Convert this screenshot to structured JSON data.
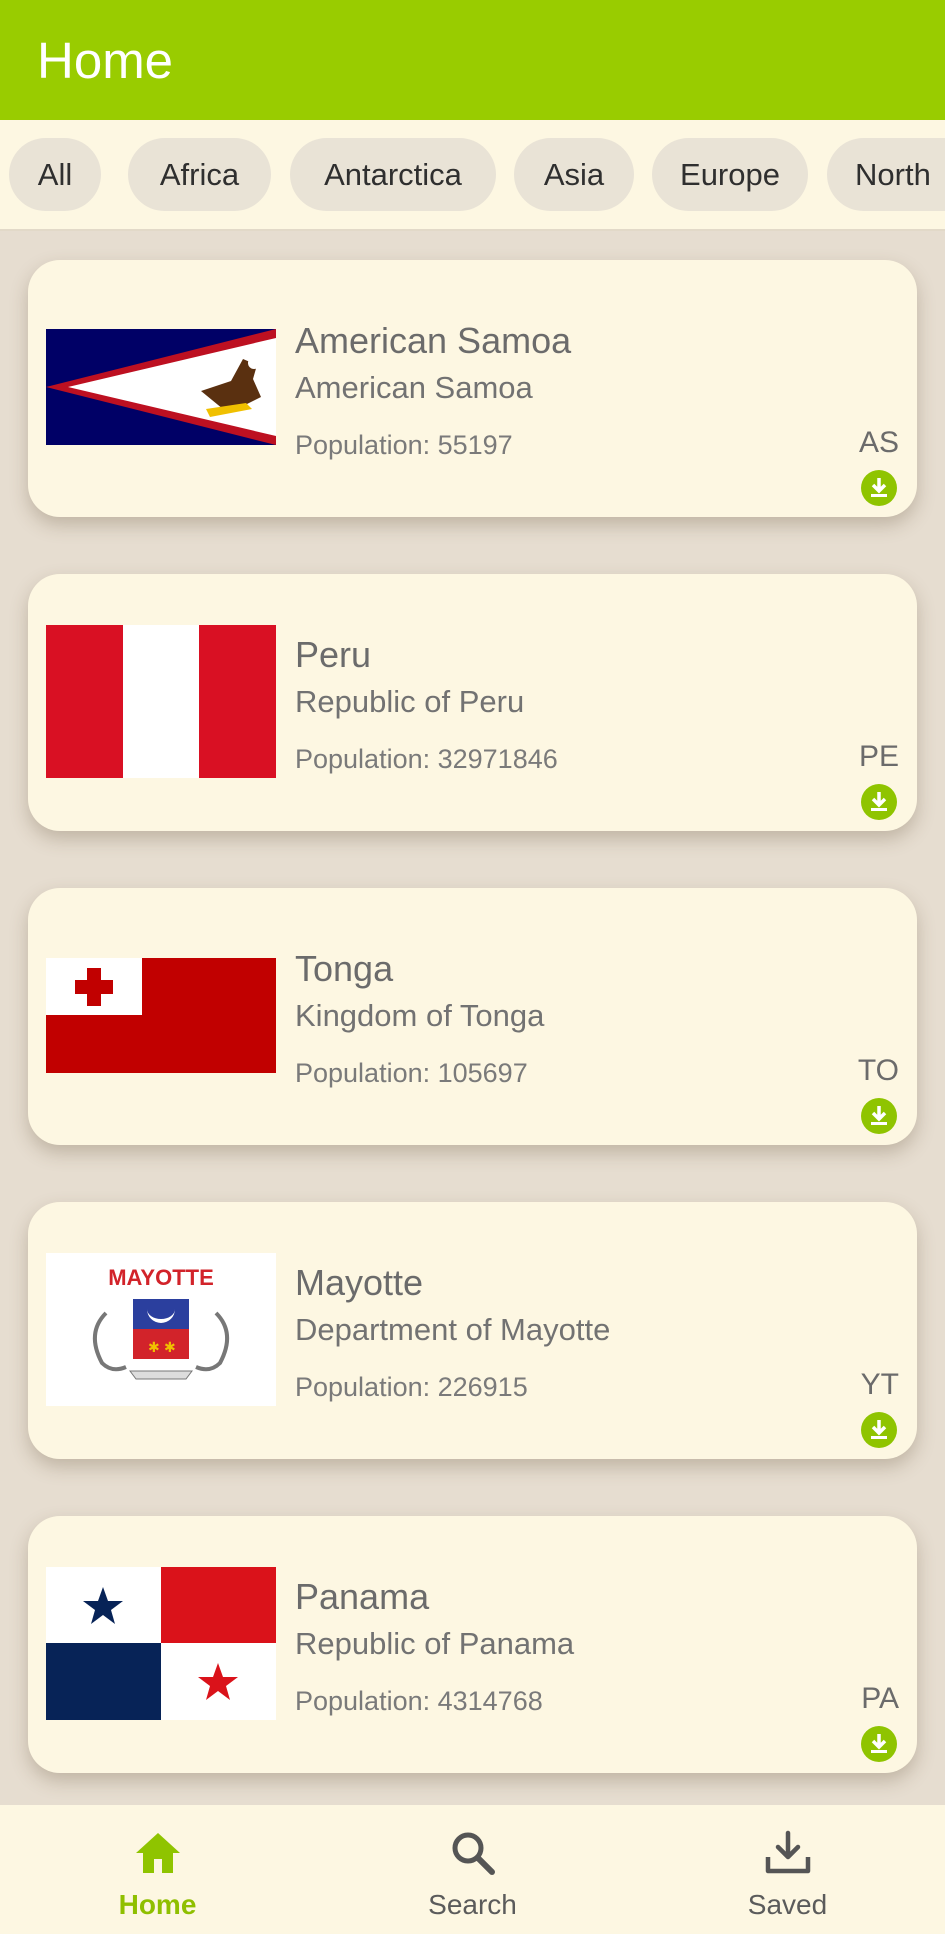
{
  "app_bar": {
    "title": "Home"
  },
  "chips": [
    "All",
    "Africa",
    "Antarctica",
    "Asia",
    "Europe",
    "North"
  ],
  "countries": [
    {
      "name": "American Samoa",
      "official": "American Samoa",
      "population": "Population: 55197",
      "code": "AS",
      "flag": "american-samoa-flag"
    },
    {
      "name": "Peru",
      "official": "Republic of Peru",
      "population": "Population: 32971846",
      "code": "PE",
      "flag": "peru-flag"
    },
    {
      "name": "Tonga",
      "official": "Kingdom of Tonga",
      "population": "Population: 105697",
      "code": "TO",
      "flag": "tonga-flag"
    },
    {
      "name": "Mayotte",
      "official": "Department of Mayotte",
      "population": "Population: 226915",
      "code": "YT",
      "flag": "mayotte-flag",
      "flag_text": "MAYOTTE"
    },
    {
      "name": "Panama",
      "official": "Republic of Panama",
      "population": "Population: 4314768",
      "code": "PA",
      "flag": "panama-flag"
    }
  ],
  "bottom_nav": [
    {
      "label": "Home",
      "icon": "home-icon",
      "active": true
    },
    {
      "label": "Search",
      "icon": "search-icon",
      "active": false
    },
    {
      "label": "Saved",
      "icon": "download-icon",
      "active": false
    }
  ],
  "colors": {
    "accent": "#99cc00",
    "card": "#fdf7e2",
    "background": "#e6ddd0"
  }
}
